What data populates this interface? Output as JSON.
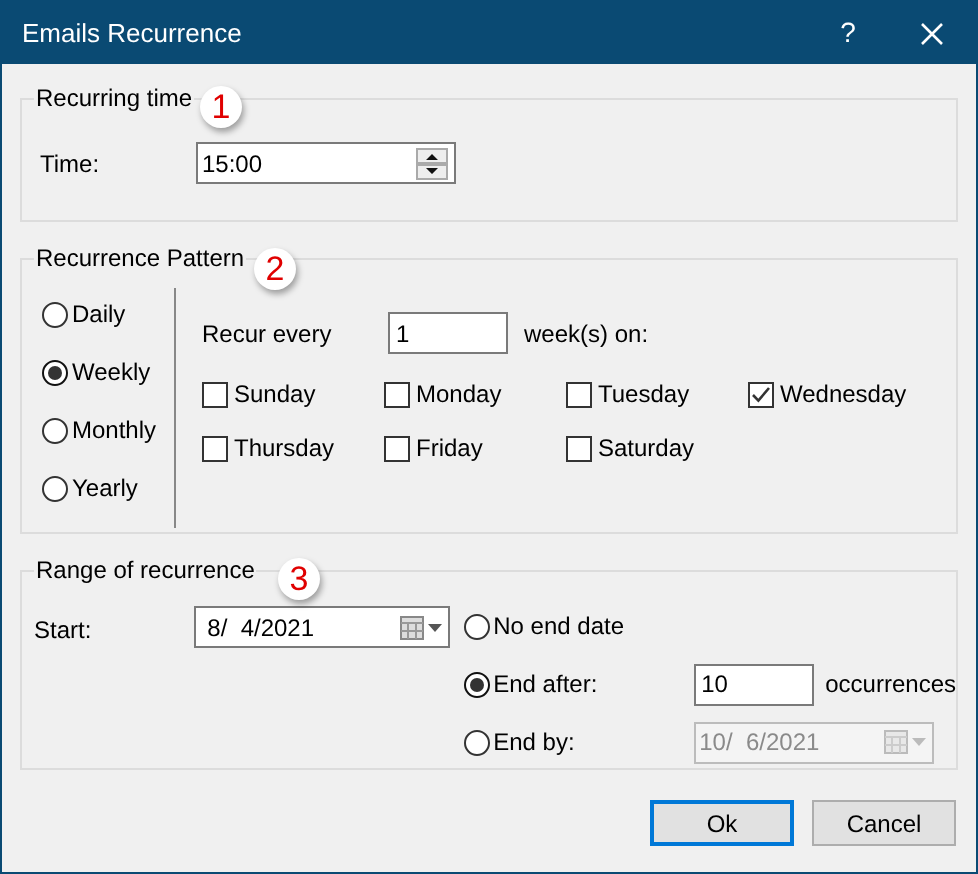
{
  "window": {
    "title": "Emails Recurrence",
    "help": "?"
  },
  "recurring_time": {
    "legend": "Recurring time",
    "badge": "1",
    "time_label": "Time:",
    "time_value": "15:00"
  },
  "recurrence_pattern": {
    "legend": "Recurrence Pattern",
    "badge": "2",
    "frequencies": [
      {
        "label": "Daily",
        "selected": false
      },
      {
        "label": "Weekly",
        "selected": true
      },
      {
        "label": "Monthly",
        "selected": false
      },
      {
        "label": "Yearly",
        "selected": false
      }
    ],
    "recur_every_label": "Recur every",
    "interval": "1",
    "interval_unit": "week(s) on:",
    "days": [
      {
        "label": "Sunday",
        "checked": false
      },
      {
        "label": "Monday",
        "checked": false
      },
      {
        "label": "Tuesday",
        "checked": false
      },
      {
        "label": "Wednesday",
        "checked": true
      },
      {
        "label": "Thursday",
        "checked": false
      },
      {
        "label": "Friday",
        "checked": false
      },
      {
        "label": "Saturday",
        "checked": false
      }
    ]
  },
  "range": {
    "legend": "Range of recurrence",
    "badge": "3",
    "start_label": "Start:",
    "start_date": "8/  4/2021",
    "end_options": [
      {
        "kind": "none",
        "label": "No end date",
        "selected": false
      },
      {
        "kind": "after",
        "label": "End after:",
        "selected": true,
        "value": "10",
        "unit": "occurrences"
      },
      {
        "kind": "by",
        "label": "End by:",
        "selected": false,
        "value": "10/  6/2021",
        "disabled": true
      }
    ]
  },
  "buttons": [
    {
      "label": "Ok",
      "default": true
    },
    {
      "label": "Cancel",
      "default": false
    }
  ]
}
